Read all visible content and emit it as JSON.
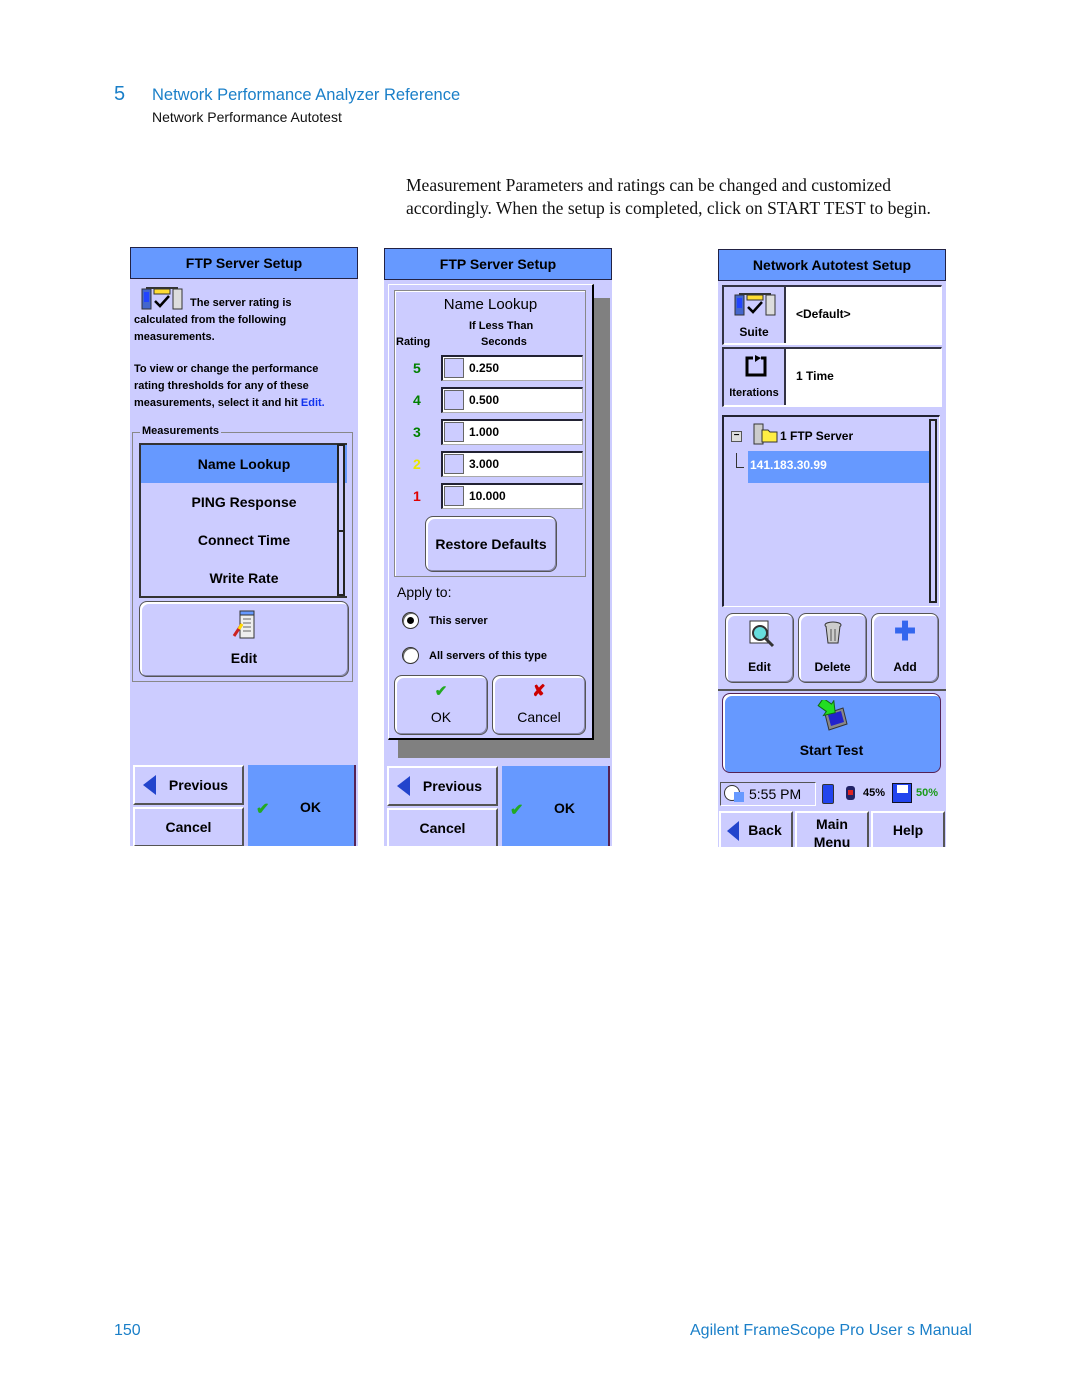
{
  "page": {
    "chapter_number": "5",
    "chapter_title": "Network Performance Analyzer Reference",
    "section_title": "Network Performance Autotest",
    "intro_text": "Measurement Parameters and ratings can be changed and customized accordingly.  When the setup is completed, click on START TEST to begin.",
    "page_number": "150",
    "footer_title": "Agilent FrameScope Pro User s Manual",
    "accent_color": "#1a7fc8"
  },
  "screen1": {
    "title": "FTP Server Setup",
    "icon": "network-test-icon",
    "desc_line1": "The server rating is",
    "desc_line2": "calculated from the following",
    "desc_line3": "measurements.",
    "help_line1": "To view or change the performance",
    "help_line2": "rating thresholds for any of these",
    "help_line3_prefix": "measurements, select it and hit",
    "help_line3_link": "Edit.",
    "measurements_label": "Measurements",
    "measurements": [
      {
        "label": "Name Lookup",
        "selected": true
      },
      {
        "label": "PING Response",
        "selected": false
      },
      {
        "label": "Connect Time",
        "selected": false
      },
      {
        "label": "Write Rate",
        "selected": false
      }
    ],
    "edit_button": "Edit",
    "previous_button": "Previous",
    "cancel_button": "Cancel",
    "ok_button": "OK"
  },
  "screen2": {
    "title": "FTP Server Setup",
    "measurement_name": "Name Lookup",
    "col_rating": "Rating",
    "col_threshold_line1": "If Less Than",
    "col_threshold_line2": "Seconds",
    "thresholds": [
      {
        "rating": "5",
        "value": "0.250",
        "color": "#008000"
      },
      {
        "rating": "4",
        "value": "0.500",
        "color": "#008000"
      },
      {
        "rating": "3",
        "value": "1.000",
        "color": "#008000"
      },
      {
        "rating": "2",
        "value": "3.000",
        "color": "#e8e800"
      },
      {
        "rating": "1",
        "value": "10.000",
        "color": "#e00000"
      }
    ],
    "restore_defaults_button": "Restore Defaults",
    "apply_to_label": "Apply to:",
    "apply_options": [
      {
        "label": "This server",
        "selected": true
      },
      {
        "label": "All servers of this type",
        "selected": false
      }
    ],
    "dialog_ok_button": "OK",
    "dialog_cancel_button": "Cancel",
    "previous_button": "Previous",
    "cancel_button": "Cancel",
    "ok_button": "OK"
  },
  "screen3": {
    "title": "Network Autotest Setup",
    "suite_label": "Suite",
    "suite_value": "<Default>",
    "iterations_label": "Iterations",
    "iterations_value": "1 Time",
    "tree_root": "1 FTP Server",
    "tree_child": "141.183.30.99",
    "edit_button": "Edit",
    "delete_button": "Delete",
    "add_button": "Add",
    "start_test_button": "Start Test",
    "time": "5:55 PM",
    "battery_percent": "45%",
    "storage_percent": "50%",
    "back_button": "Back",
    "main_menu_line1": "Main",
    "main_menu_line2": "Menu",
    "help_button": "Help"
  }
}
